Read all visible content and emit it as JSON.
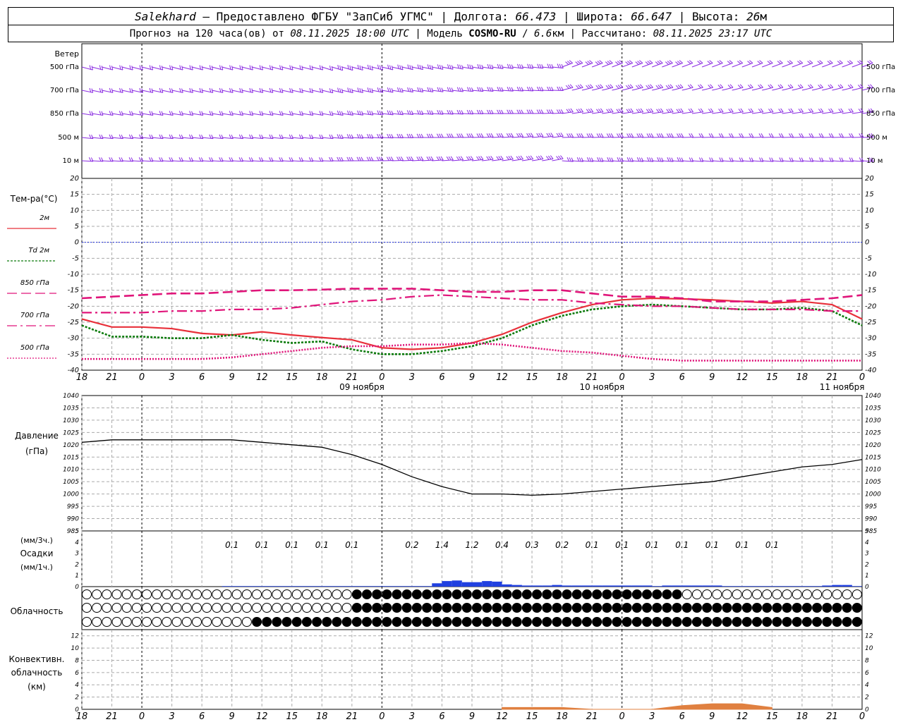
{
  "header": {
    "station": "Salekhard",
    "provider": "— Предоставлено ФГБУ \"ЗапСиб УГМС\" | Долгота:",
    "lon": "66.473",
    "lat_label": "| Широта:",
    "lat": "66.647",
    "alt_label": "| Высота:",
    "alt": "26",
    "alt_unit": "м",
    "forecast_label": "Прогноз на 120 часа(ов) от",
    "start": "08.11.2025 18:00 UTC",
    "model_label": "| Модель",
    "model": "COSMO-RU",
    "res": "6.6",
    "res_unit": "км",
    "calc_label": "| Рассчитано:",
    "calc": "08.11.2025 23:17 UTC"
  },
  "colors": {
    "wind": "#8a2be2",
    "t2m": "#e8303a",
    "td2m": "#0a7a0a",
    "t850": "#e0157a",
    "zero": "#2030e0",
    "pressure": "#000000",
    "precip": "#2040e0",
    "conv": "#e08040",
    "grid": "#aaaaaa"
  },
  "wind_panel": {
    "title": "Ветер",
    "levels": [
      "500 гПа",
      "700 гПа",
      "850 гПа",
      "500 м",
      "10  м"
    ],
    "right_levels": [
      "500 гПа",
      "700 гПа",
      "850 гПа",
      "500 м",
      "10  м"
    ]
  },
  "time_axis": {
    "hour_ticks": [
      "18",
      "21",
      "0",
      "3",
      "6",
      "9",
      "12",
      "15",
      "18",
      "21",
      "0",
      "3",
      "6",
      "9",
      "12",
      "15",
      "18",
      "21",
      "0",
      "3",
      "6",
      "9",
      "12",
      "15",
      "18",
      "21",
      "0"
    ],
    "day_labels": [
      "09 ноября",
      "10 ноября",
      "11 ноября"
    ]
  },
  "temp_legend": {
    "title": "Тем-ра(°C)",
    "items": [
      {
        "label": "2м",
        "color": "#e8303a",
        "style": "solid"
      },
      {
        "label": "Td  2м",
        "color": "#0a7a0a",
        "style": "dotted"
      },
      {
        "label": "850 гПа",
        "color": "#e0157a",
        "style": "dashed"
      },
      {
        "label": "700 гПа",
        "color": "#e0157a",
        "style": "dashdot"
      },
      {
        "label": "500 гПа",
        "color": "#e0157a",
        "style": "dotted"
      }
    ]
  },
  "pressure_panel": {
    "title": "Давление",
    "unit": "(гПа)"
  },
  "precip_panel": {
    "unit_3h": "(мм/3ч.)",
    "title": "Осадки",
    "unit_1h": "(мм/1ч.)"
  },
  "cloud_panel": {
    "title": "Облачность"
  },
  "conv_panel": {
    "title": "Конвективн.",
    "title2": "облачность",
    "unit": "(км)"
  },
  "chart_data": [
    {
      "type": "line",
      "title": "Тем-ра(°C)",
      "x_hours": [
        0,
        3,
        6,
        9,
        12,
        15,
        18,
        21,
        24,
        27,
        30,
        33,
        36,
        39,
        42,
        45,
        48,
        51,
        54,
        57,
        60,
        63,
        66,
        69,
        72,
        75,
        78
      ],
      "ylim": [
        -40,
        20
      ],
      "yticks": [
        20,
        15,
        10,
        5,
        0,
        -5,
        -10,
        -15,
        -20,
        -25,
        -30,
        -35,
        -40
      ],
      "series": [
        {
          "name": "2м",
          "values": [
            -24,
            -26.5,
            -26.5,
            -27,
            -28.5,
            -29,
            -28,
            -29,
            -29.8,
            -30.5,
            -33,
            -33.5,
            -33,
            -31.5,
            -28.8,
            -25,
            -22,
            -19.5,
            -18,
            -17.5,
            -17.7,
            -18,
            -18.5,
            -19,
            -18.5,
            -19.5,
            -24
          ]
        },
        {
          "name": "Td  2м",
          "values": [
            -26,
            -29.5,
            -29.5,
            -30,
            -30,
            -29,
            -30.5,
            -31.5,
            -31,
            -33.5,
            -35,
            -35,
            -34,
            -32.5,
            -30,
            -26,
            -23,
            -21,
            -20,
            -19.5,
            -20,
            -20.5,
            -21,
            -21,
            -20.5,
            -21.5,
            -26
          ]
        },
        {
          "name": "850 гПа",
          "values": [
            -17.5,
            -17,
            -16.5,
            -16,
            -16,
            -15.5,
            -15,
            -15,
            -14.8,
            -14.5,
            -14.5,
            -14.5,
            -15,
            -15.5,
            -15.5,
            -15,
            -15,
            -16,
            -17,
            -17,
            -17.5,
            -18.5,
            -18.5,
            -18.5,
            -18,
            -17.5,
            -16.5
          ]
        },
        {
          "name": "700 гПа",
          "values": [
            -22,
            -22,
            -22,
            -21.5,
            -21.5,
            -21,
            -21,
            -20.5,
            -19.5,
            -18.5,
            -18,
            -17,
            -16.5,
            -17,
            -17.5,
            -18,
            -18,
            -19,
            -19.5,
            -20,
            -20,
            -20.5,
            -21,
            -21,
            -21,
            -21.5,
            -21.5
          ]
        },
        {
          "name": "500 гПа",
          "values": [
            -36.5,
            -36.5,
            -36.5,
            -36.5,
            -36.5,
            -36,
            -35,
            -34,
            -33,
            -32.5,
            -32.5,
            -32,
            -32,
            -31.5,
            -32,
            -33,
            -34,
            -34.5,
            -35.5,
            -36.5,
            -37,
            -37,
            -37,
            -37,
            -37,
            -37,
            -37
          ]
        }
      ]
    },
    {
      "type": "line",
      "title": "Давление",
      "x_hours": [
        0,
        3,
        6,
        9,
        12,
        15,
        18,
        21,
        24,
        27,
        30,
        33,
        36,
        39,
        42,
        45,
        48,
        51,
        54,
        57,
        60,
        63,
        66,
        69,
        72,
        75,
        78
      ],
      "ylim": [
        985,
        1040
      ],
      "yticks": [
        1040,
        1035,
        1030,
        1025,
        1020,
        1015,
        1010,
        1005,
        1000,
        995,
        990,
        985
      ],
      "series": [
        {
          "name": "",
          "values": [
            1021,
            1022,
            1022,
            1022,
            1022,
            1022,
            1021,
            1020,
            1019,
            1016,
            1012,
            1007,
            1003,
            1000,
            1000,
            999.5,
            1000,
            1001,
            1002,
            1003,
            1004,
            1005,
            1007,
            1009,
            1011,
            1012,
            1014
          ]
        }
      ]
    },
    {
      "type": "bar",
      "title": "Осадки",
      "ylim": [
        0,
        5
      ],
      "yticks": [
        5,
        4,
        3,
        2,
        1,
        0
      ],
      "labels_3h": [
        "0.1",
        "0.1",
        "0.1",
        "0.1",
        "0.1",
        "0.2",
        "1.4",
        "1.2",
        "0.4",
        "0.3",
        "0.2",
        "0.1",
        "0.1",
        "0.1",
        "0.1",
        "0.1",
        "0.1",
        "0.1"
      ],
      "labels_3h_hour": [
        15,
        18,
        21,
        24,
        27,
        33,
        36,
        39,
        42,
        45,
        48,
        51,
        54,
        57,
        60,
        63,
        66,
        69
      ],
      "hourly_hours": [
        14,
        15,
        16,
        17,
        18,
        19,
        20,
        21,
        22,
        23,
        24,
        25,
        26,
        27,
        28,
        29,
        30,
        31,
        32,
        33,
        34,
        35,
        36,
        37,
        38,
        39,
        40,
        41,
        42,
        43,
        44,
        45,
        46,
        47,
        48,
        49,
        50,
        51,
        52,
        53,
        54,
        55,
        56,
        57,
        58,
        59,
        60,
        61,
        62,
        63,
        64,
        65,
        66,
        67,
        68,
        69,
        70,
        71,
        72,
        73,
        74,
        75,
        76,
        77
      ],
      "hourly_values": [
        0.05,
        0.05,
        0.05,
        0.05,
        0.05,
        0.05,
        0.05,
        0.05,
        0.05,
        0.05,
        0.05,
        0.05,
        0.05,
        0.05,
        0.05,
        0.05,
        0.05,
        0.05,
        0.05,
        0.05,
        0.05,
        0.3,
        0.5,
        0.55,
        0.4,
        0.4,
        0.5,
        0.45,
        0.2,
        0.15,
        0.1,
        0.1,
        0.1,
        0.15,
        0.1,
        0.1,
        0.1,
        0.1,
        0.1,
        0.1,
        0.1,
        0.1,
        0.1,
        0.05,
        0.1,
        0.1,
        0.1,
        0.1,
        0.1,
        0.1,
        0.05,
        0.05,
        0.05,
        0.05,
        0.05,
        0.05,
        0.05,
        0.05,
        0.05,
        0.05,
        0.1,
        0.15,
        0.15,
        0.05
      ]
    },
    {
      "type": "area",
      "title": "Конвективн. облачность",
      "ylim": [
        0,
        13
      ],
      "yticks": [
        12,
        10,
        8,
        6,
        4,
        2,
        0
      ],
      "x_hours": [
        42,
        45,
        48,
        51,
        54,
        57,
        60,
        63,
        66,
        69
      ],
      "values": [
        0.3,
        0.3,
        0.3,
        0,
        0,
        0,
        0.6,
        0.9,
        0.9,
        0.3
      ]
    }
  ]
}
